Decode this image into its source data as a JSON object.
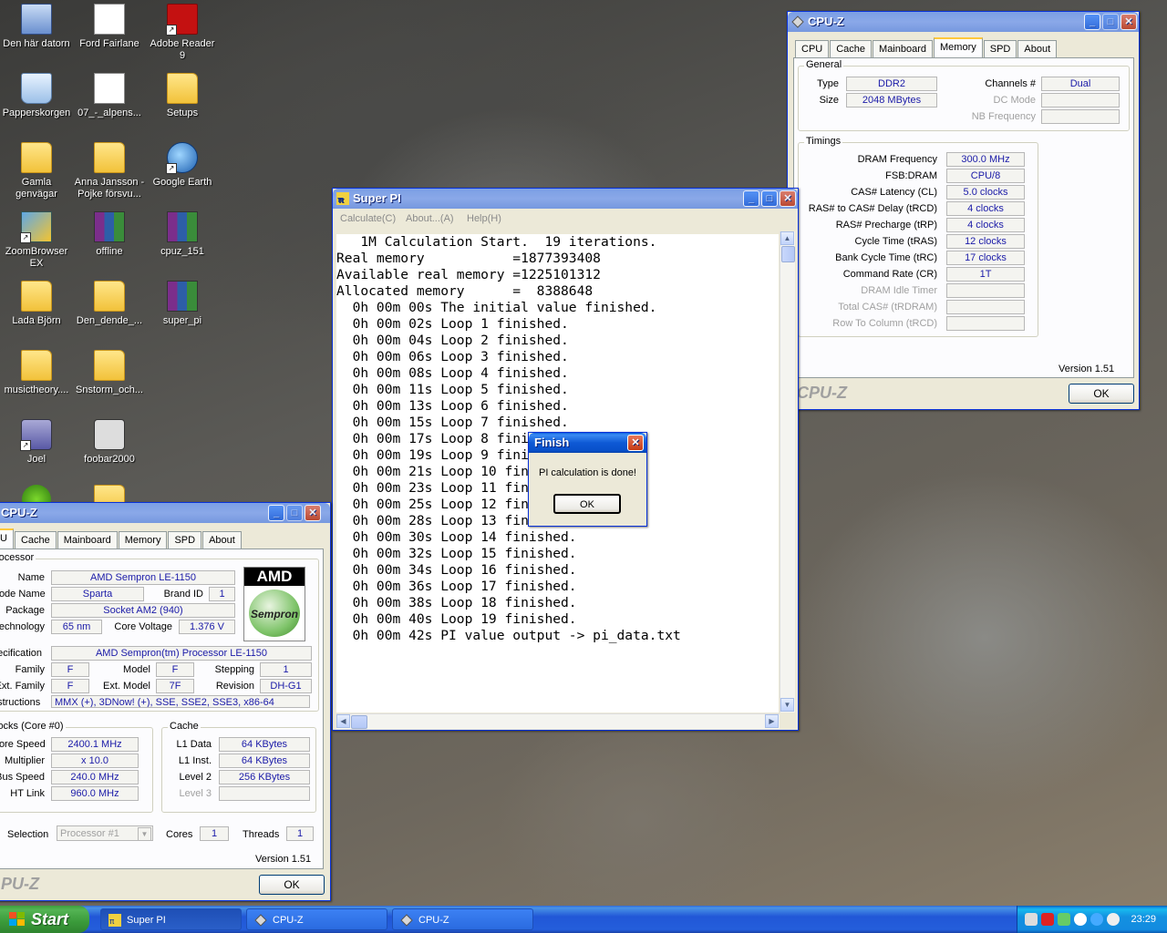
{
  "desktop": {
    "icons": [
      {
        "label": "Den här datorn",
        "icon": "computer-icon"
      },
      {
        "label": "Ford Fairlane",
        "icon": "document-icon"
      },
      {
        "label": "Adobe Reader 9",
        "icon": "pdf-icon"
      },
      {
        "label": "Papperskorgen",
        "icon": "recycle-bin-icon"
      },
      {
        "label": "07_-_alpens...",
        "icon": "mp3-icon"
      },
      {
        "label": "Setups",
        "icon": "folder-icon"
      },
      {
        "label": "Gamla genvägar",
        "icon": "folder-icon"
      },
      {
        "label": "Anna Jansson - Pojke försvu...",
        "icon": "folder-icon"
      },
      {
        "label": "Google Earth",
        "icon": "earth-icon"
      },
      {
        "label": "ZoomBrowser EX",
        "icon": "zoombrowser-icon"
      },
      {
        "label": "offline",
        "icon": "rar-icon"
      },
      {
        "label": "cpuz_151",
        "icon": "rar-icon"
      },
      {
        "label": "Lada Björn",
        "icon": "folder-icon"
      },
      {
        "label": "Den_dende_...",
        "icon": "folder-icon"
      },
      {
        "label": "super_pi",
        "icon": "rar-icon"
      },
      {
        "label": "musictheory....",
        "icon": "folder-icon"
      },
      {
        "label": "Snstorm_och...",
        "icon": "folder-icon"
      },
      {
        "label": "Joel",
        "icon": "drive-icon"
      },
      {
        "label": "foobar2000",
        "icon": "foobar-icon"
      }
    ]
  },
  "superpi": {
    "title": "Super PI",
    "menu": [
      "Calculate(C)",
      "About...(A)",
      "Help(H)"
    ],
    "lines": [
      "   1M Calculation Start.  19 iterations.",
      "Real memory           =1877393408",
      "Available real memory =1225101312",
      "Allocated memory      =  8388648",
      "  0h 00m 00s The initial value finished.",
      "  0h 00m 02s Loop 1 finished.",
      "  0h 00m 04s Loop 2 finished.",
      "  0h 00m 06s Loop 3 finished.",
      "  0h 00m 08s Loop 4 finished.",
      "  0h 00m 11s Loop 5 finished.",
      "  0h 00m 13s Loop 6 finished.",
      "  0h 00m 15s Loop 7 finished.",
      "  0h 00m 17s Loop 8 finished.",
      "  0h 00m 19s Loop 9 finished.",
      "  0h 00m 21s Loop 10 finished.",
      "  0h 00m 23s Loop 11 finished.",
      "  0h 00m 25s Loop 12 finished.",
      "  0h 00m 28s Loop 13 finished.",
      "  0h 00m 30s Loop 14 finished.",
      "  0h 00m 32s Loop 15 finished.",
      "  0h 00m 34s Loop 16 finished.",
      "  0h 00m 36s Loop 17 finished.",
      "  0h 00m 38s Loop 18 finished.",
      "  0h 00m 40s Loop 19 finished.",
      "  0h 00m 42s PI value output -> pi_data.txt"
    ]
  },
  "finish_dialog": {
    "title": "Finish",
    "message": "PI calculation is done!",
    "ok": "OK"
  },
  "cpuz_mem": {
    "title": "CPU-Z",
    "tabs": [
      "CPU",
      "Cache",
      "Mainboard",
      "Memory",
      "SPD",
      "About"
    ],
    "general_title": "General",
    "type_label": "Type",
    "type": "DDR2",
    "size_label": "Size",
    "size": "2048 MBytes",
    "channels_label": "Channels #",
    "channels": "Dual",
    "dc_mode_label": "DC Mode",
    "nb_freq_label": "NB Frequency",
    "timings_title": "Timings",
    "timings": [
      {
        "label": "DRAM Frequency",
        "value": "300.0 MHz"
      },
      {
        "label": "FSB:DRAM",
        "value": "CPU/8"
      },
      {
        "label": "CAS# Latency (CL)",
        "value": "5.0 clocks"
      },
      {
        "label": "RAS# to CAS# Delay (tRCD)",
        "value": "4 clocks"
      },
      {
        "label": "RAS# Precharge (tRP)",
        "value": "4 clocks"
      },
      {
        "label": "Cycle Time (tRAS)",
        "value": "12 clocks"
      },
      {
        "label": "Bank Cycle Time (tRC)",
        "value": "17 clocks"
      },
      {
        "label": "Command Rate (CR)",
        "value": "1T"
      },
      {
        "label": "DRAM Idle Timer",
        "value": ""
      },
      {
        "label": "Total CAS# (tRDRAM)",
        "value": ""
      },
      {
        "label": "Row To Column (tRCD)",
        "value": ""
      }
    ],
    "version": "Version 1.51",
    "brand": "CPU-Z",
    "ok": "OK"
  },
  "cpuz_cpu": {
    "title": "CPU-Z",
    "tabs": [
      "U",
      "Cache",
      "Mainboard",
      "Memory",
      "SPD",
      "About"
    ],
    "processor_title": "rocessor",
    "name_label": "Name",
    "name": "AMD Sempron LE-1150",
    "codename_label": "Code Name",
    "codename": "Sparta",
    "brandid_label": "Brand ID",
    "brandid": "1",
    "package_label": "Package",
    "package": "Socket AM2 (940)",
    "tech_label": "Technology",
    "tech": "65 nm",
    "voltage_label": "Core Voltage",
    "voltage": "1.376 V",
    "spec_label": "pecification",
    "spec": "AMD Sempron(tm) Processor LE-1150",
    "family_label": "Family",
    "family": "F",
    "model_label": "Model",
    "model": "F",
    "stepping_label": "Stepping",
    "stepping": "1",
    "extfamily_label": "Ext. Family",
    "extfamily": "F",
    "extmodel_label": "Ext. Model",
    "extmodel": "7F",
    "revision_label": "Revision",
    "revision": "DH-G1",
    "instr_label": "nstructions",
    "instr": "MMX (+), 3DNow! (+), SSE, SSE2, SSE3, x86-64",
    "clocks_title": "locks (Core #0)",
    "corespeed_label": "Core Speed",
    "corespeed": "2400.1 MHz",
    "multiplier_label": "Multiplier",
    "multiplier": "x 10.0",
    "busspeed_label": "Bus Speed",
    "busspeed": "240.0 MHz",
    "htlink_label": "HT Link",
    "htlink": "960.0 MHz",
    "cache_title": "Cache",
    "l1d_label": "L1 Data",
    "l1d": "64 KBytes",
    "l1i_label": "L1 Inst.",
    "l1i": "64 KBytes",
    "l2_label": "Level 2",
    "l2": "256 KBytes",
    "l3_label": "Level 3",
    "selection_label": "Selection",
    "selection": "Processor #1",
    "cores_label": "Cores",
    "cores": "1",
    "threads_label": "Threads",
    "threads": "1",
    "version": "Version 1.51",
    "brand": "PU-Z",
    "ok": "OK",
    "logo_top": "AMD",
    "logo_bottom": "Sempron"
  },
  "taskbar": {
    "start": "Start",
    "tasks": [
      "Super PI",
      "CPU-Z",
      "CPU-Z"
    ],
    "clock": "23:29"
  }
}
